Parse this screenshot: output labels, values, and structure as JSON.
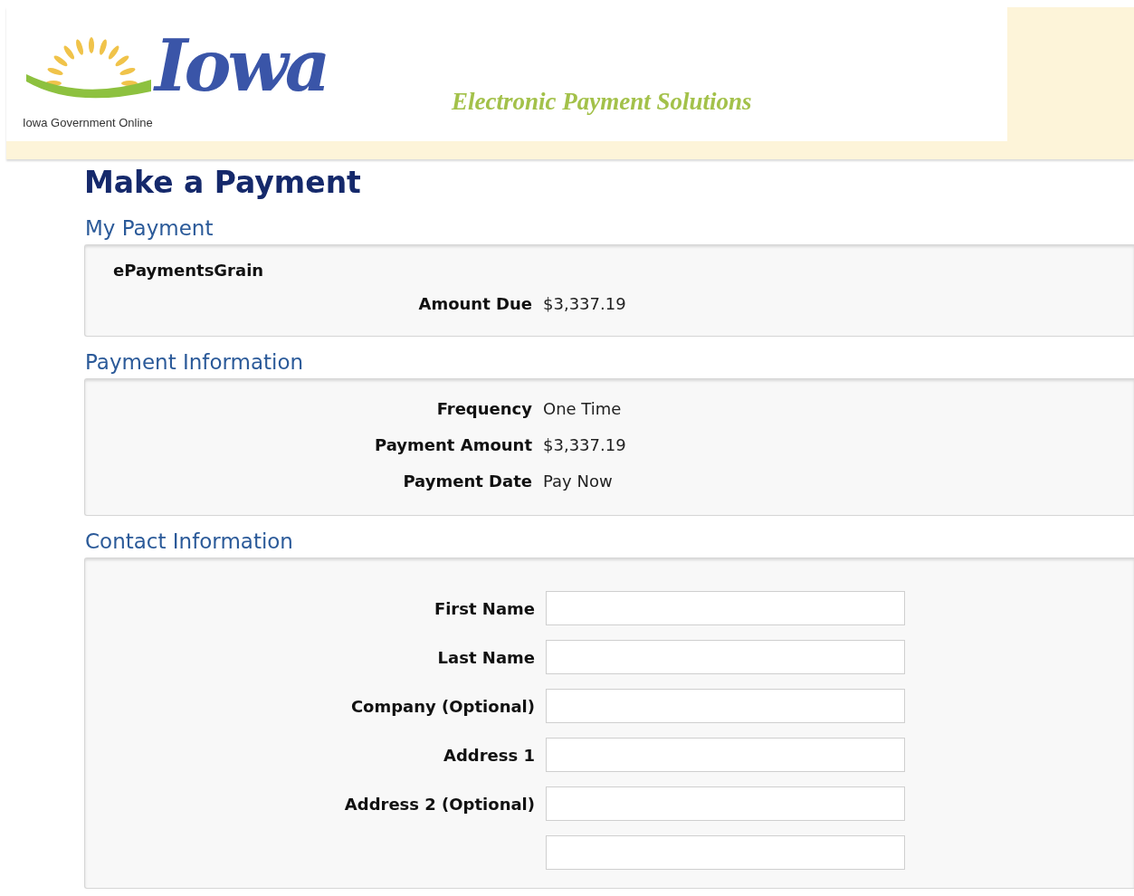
{
  "header": {
    "logo_word": "Iowa",
    "logo_caption": "Iowa Government Online",
    "tagline": "Electronic Payment Solutions"
  },
  "page_title": "Make a Payment",
  "my_payment": {
    "title": "My Payment",
    "item_name": "ePaymentsGrain",
    "rows": [
      {
        "label": "Amount Due",
        "value": "$3,337.19"
      }
    ]
  },
  "payment_information": {
    "title": "Payment Information",
    "rows": [
      {
        "label": "Frequency",
        "value": "One Time"
      },
      {
        "label": "Payment Amount",
        "value": "$3,337.19"
      },
      {
        "label": "Payment Date",
        "value": "Pay Now"
      }
    ]
  },
  "contact_information": {
    "title": "Contact Information",
    "fields": [
      {
        "kind": "labeled",
        "label": "First Name"
      },
      {
        "kind": "labeled",
        "label": "Last Name"
      },
      {
        "kind": "labeled",
        "label": "Company (Optional)"
      },
      {
        "kind": "labeled",
        "label": "Address 1"
      },
      {
        "kind": "labeled",
        "label": "Address 2 (Optional)"
      },
      {
        "kind": "unlabeled"
      }
    ]
  }
}
